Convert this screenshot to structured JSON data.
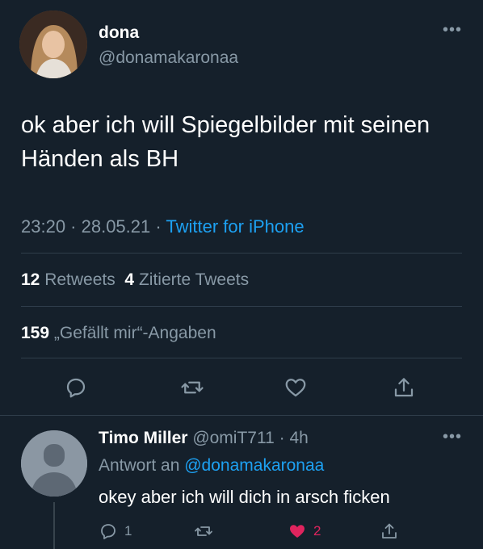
{
  "tweet": {
    "author_name": "dona",
    "author_handle": "@donamakaronaa",
    "more_label": "•••",
    "text": "ok aber ich will Spiegelbilder mit seinen Händen als BH",
    "time": "23:20 · 28.05.21 · ",
    "source": "Twitter for iPhone",
    "retweets_count": "12",
    "retweets_label": "Retweets",
    "quotes_count": "4",
    "quotes_label": "Zitierte Tweets",
    "likes_count": "159",
    "likes_label": "„Gefällt mir“-Angaben"
  },
  "actions": [
    {
      "icon": "reply-icon"
    },
    {
      "icon": "retweet-icon"
    },
    {
      "icon": "like-icon"
    },
    {
      "icon": "share-icon"
    }
  ],
  "reply": {
    "author_name": "Timo Miller",
    "author_handle": "@omiT711",
    "time": " · 4h",
    "reply_prefix": "Antwort an ",
    "reply_to": "@donamakaronaa",
    "text": "okey aber ich will dich in arsch ficken",
    "more_label": "•••",
    "reply_count": "1",
    "like_count": "2",
    "like_color": "#e0245e"
  },
  "colors": {
    "background": "#15202b",
    "accent": "#1da1f2",
    "muted": "#8899a6"
  }
}
